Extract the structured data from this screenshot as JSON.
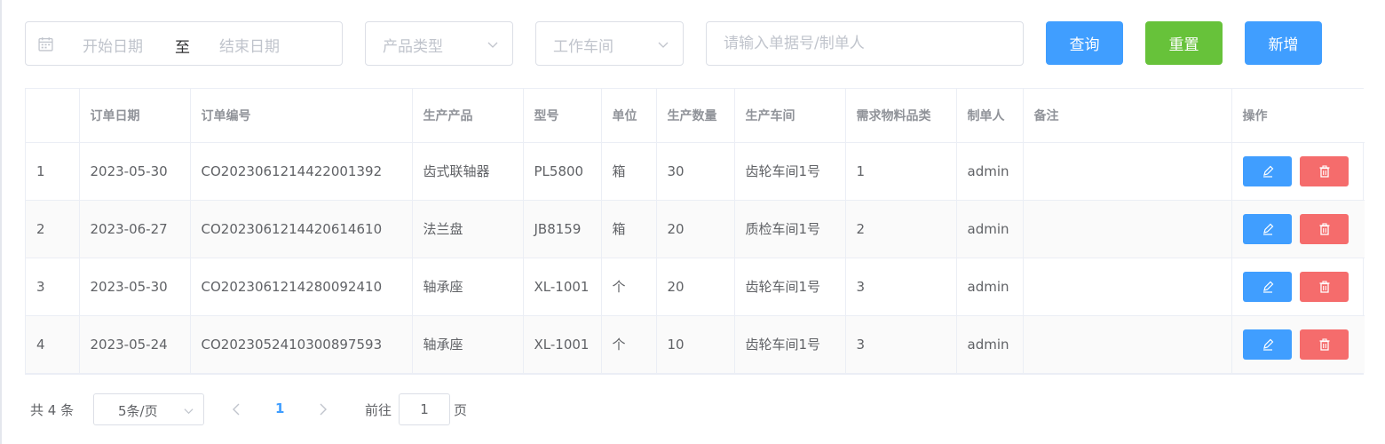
{
  "filters": {
    "date_start_placeholder": "开始日期",
    "date_separator": "至",
    "date_end_placeholder": "结束日期",
    "product_type_placeholder": "产品类型",
    "workshop_placeholder": "工作车间",
    "search_placeholder": "请输入单据号/制单人"
  },
  "buttons": {
    "query": "查询",
    "reset": "重置",
    "add": "新增"
  },
  "colors": {
    "primary": "#409eff",
    "success": "#67c23a",
    "danger": "#f56c6c"
  },
  "table": {
    "columns": [
      "",
      "订单日期",
      "订单编号",
      "生产产品",
      "型号",
      "单位",
      "生产数量",
      "生产车间",
      "需求物料品类",
      "制单人",
      "备注",
      "操作"
    ],
    "rows": [
      [
        "1",
        "2023-05-30",
        "CO2023061214422001392",
        "齿式联轴器",
        "PL5800",
        "箱",
        "30",
        "齿轮车间1号",
        "1",
        "admin",
        ""
      ],
      [
        "2",
        "2023-06-27",
        "CO2023061214420614610",
        "法兰盘",
        "JB8159",
        "箱",
        "20",
        "质检车间1号",
        "2",
        "admin",
        ""
      ],
      [
        "3",
        "2023-05-30",
        "CO2023061214280092410",
        "轴承座",
        "XL-1001",
        "个",
        "20",
        "齿轮车间1号",
        "3",
        "admin",
        ""
      ],
      [
        "4",
        "2023-05-24",
        "CO2023052410300897593",
        "轴承座",
        "XL-1001",
        "个",
        "10",
        "齿轮车间1号",
        "3",
        "admin",
        ""
      ]
    ],
    "row_actions": [
      "edit-icon",
      "trash-icon"
    ]
  },
  "pagination": {
    "total": "共 4 条",
    "page_size": "5条/页",
    "current_page": "1",
    "goto_label": "前往",
    "goto_value": "1",
    "goto_suffix": "页"
  }
}
